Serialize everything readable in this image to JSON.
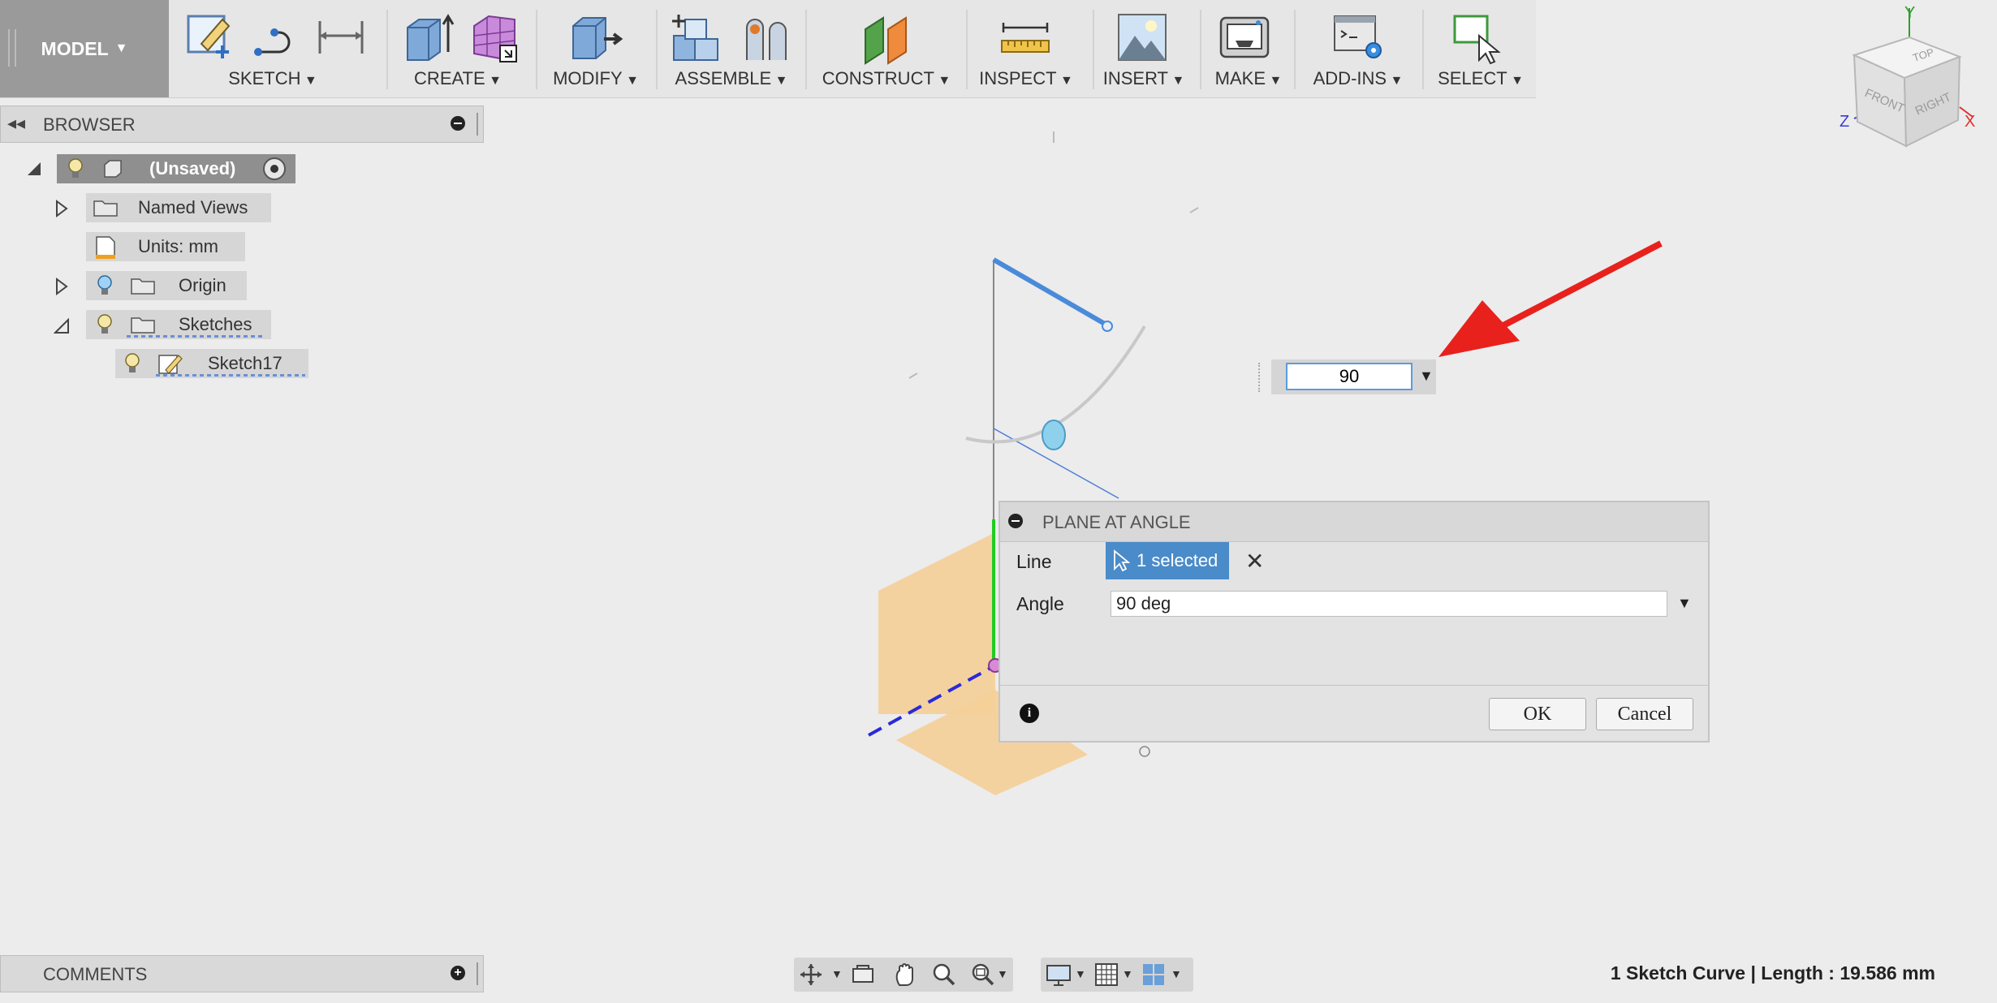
{
  "toolbar": {
    "model_label": "MODEL",
    "groups": {
      "sketch": "SKETCH",
      "create": "CREATE",
      "modify": "MODIFY",
      "assemble": "ASSEMBLE",
      "construct": "CONSTRUCT",
      "inspect": "INSPECT",
      "insert": "INSERT",
      "make": "MAKE",
      "addins": "ADD-INS",
      "select": "SELECT"
    }
  },
  "browser": {
    "title": "BROWSER",
    "items": {
      "root": "(Unsaved)",
      "named_views": "Named Views",
      "units": "Units: mm",
      "origin": "Origin",
      "sketches": "Sketches",
      "sketch17": "Sketch17"
    }
  },
  "viewcube": {
    "top": "TOP",
    "front": "FRONT",
    "right": "RIGHT",
    "axis_x": "X",
    "axis_y": "Y",
    "axis_z": "Z"
  },
  "inline_value": "90",
  "dialog": {
    "title": "PLANE AT ANGLE",
    "line_label": "Line",
    "selected_label": "1 selected",
    "angle_label": "Angle",
    "angle_value": "90 deg",
    "ok_label": "OK",
    "cancel_label": "Cancel"
  },
  "comments": {
    "title": "COMMENTS"
  },
  "status_text": "1 Sketch Curve | Length : 19.586 mm",
  "colors": {
    "selection_blue": "#4a8bc9",
    "arrow_red": "#e8211d",
    "plane_orange": "#f5cf98",
    "axis_green": "#22cc22"
  }
}
